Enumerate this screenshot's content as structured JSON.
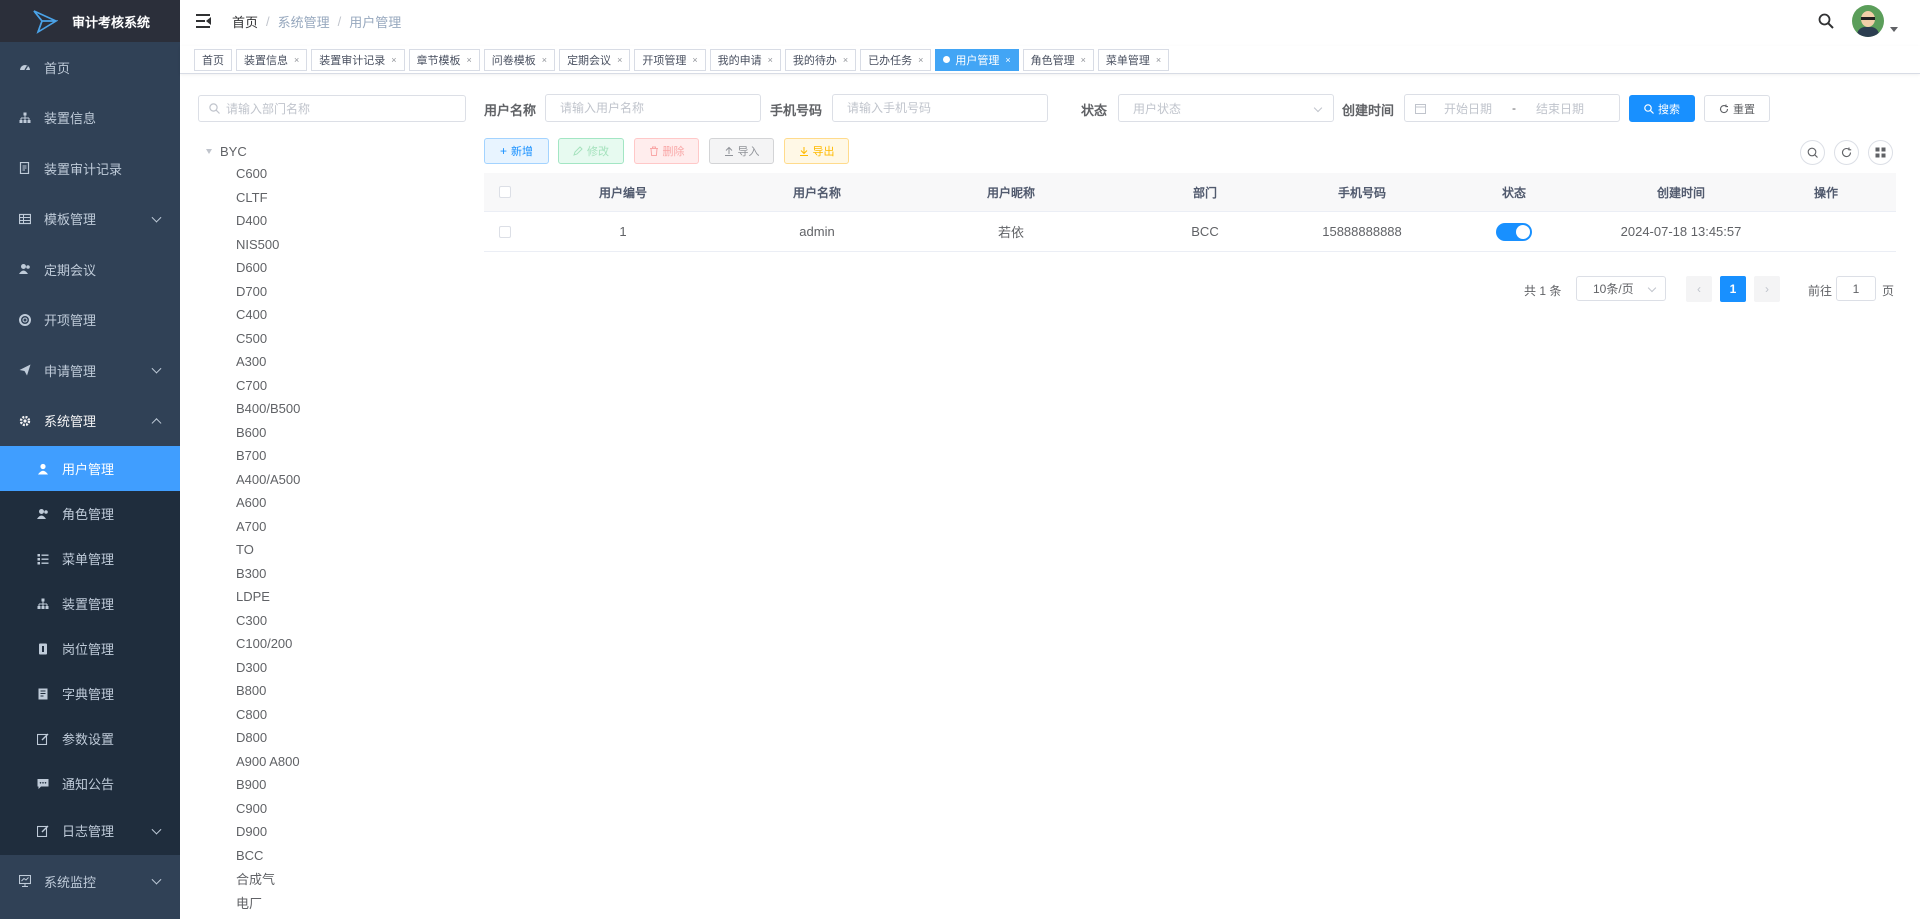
{
  "app": {
    "title": "审计考核系统"
  },
  "sidebar": {
    "items": [
      {
        "label": "首页",
        "icon": "dashboard-icon"
      },
      {
        "label": "装置信息",
        "icon": "tree-icon"
      },
      {
        "label": "装置审计记录",
        "icon": "document-icon"
      },
      {
        "label": "模板管理",
        "icon": "table-icon",
        "expandable": true
      },
      {
        "label": "定期会议",
        "icon": "people-icon"
      },
      {
        "label": "开项管理",
        "icon": "lifebuoy-icon"
      },
      {
        "label": "申请管理",
        "icon": "send-icon",
        "expandable": true
      },
      {
        "label": "系统管理",
        "icon": "gear-icon",
        "expanded": true
      }
    ],
    "system_submenu": [
      {
        "label": "用户管理",
        "icon": "user-icon",
        "active": true
      },
      {
        "label": "角色管理",
        "icon": "peoples-icon"
      },
      {
        "label": "菜单管理",
        "icon": "tree-table-icon"
      },
      {
        "label": "装置管理",
        "icon": "tree-icon"
      },
      {
        "label": "岗位管理",
        "icon": "post-icon"
      },
      {
        "label": "字典管理",
        "icon": "dict-icon"
      },
      {
        "label": "参数设置",
        "icon": "edit-icon"
      },
      {
        "label": "通知公告",
        "icon": "message-icon"
      },
      {
        "label": "日志管理",
        "icon": "log-icon",
        "expandable": true
      }
    ],
    "monitor": {
      "label": "系统监控",
      "icon": "monitor-icon",
      "expandable": true
    }
  },
  "header": {
    "breadcrumb": [
      "首页",
      "系统管理",
      "用户管理"
    ],
    "sep": "/"
  },
  "tags": [
    {
      "label": "首页",
      "closable": false
    },
    {
      "label": "装置信息",
      "closable": true
    },
    {
      "label": "装置审计记录",
      "closable": true
    },
    {
      "label": "章节模板",
      "closable": true
    },
    {
      "label": "问卷模板",
      "closable": true
    },
    {
      "label": "定期会议",
      "closable": true
    },
    {
      "label": "开项管理",
      "closable": true
    },
    {
      "label": "我的申请",
      "closable": true
    },
    {
      "label": "我的待办",
      "closable": true
    },
    {
      "label": "已办任务",
      "closable": true
    },
    {
      "label": "用户管理",
      "closable": true,
      "active": true
    },
    {
      "label": "角色管理",
      "closable": true
    },
    {
      "label": "菜单管理",
      "closable": true
    }
  ],
  "tag_close": "×",
  "dept_tree": {
    "search_placeholder": "请输入部门名称",
    "root": "BYC",
    "children": [
      "C600",
      "CLTF",
      "D400",
      "NIS500",
      "D600",
      "D700",
      "C400",
      "C500",
      "A300",
      "C700",
      "B400/B500",
      "B600",
      "B700",
      "A400/A500",
      "A600",
      "A700",
      "TO",
      "B300",
      "LDPE",
      "C300",
      "C100/200",
      "D300",
      "B800",
      "C800",
      "D800",
      "A900 A800",
      "B900",
      "C900",
      "D900",
      "BCC",
      "合成气",
      "电厂"
    ]
  },
  "query": {
    "username_label": "用户名称",
    "username_placeholder": "请输入用户名称",
    "phone_label": "手机号码",
    "phone_placeholder": "请输入手机号码",
    "status_label": "状态",
    "status_placeholder": "用户状态",
    "created_label": "创建时间",
    "start_placeholder": "开始日期",
    "range_sep": "-",
    "end_placeholder": "结束日期",
    "search_btn": "搜索",
    "reset_btn": "重置"
  },
  "toolbar": {
    "add": "新增",
    "edit": "修改",
    "delete": "删除",
    "import": "导入",
    "export": "导出"
  },
  "table": {
    "headers": [
      "用户编号",
      "用户名称",
      "用户昵称",
      "部门",
      "手机号码",
      "状态",
      "创建时间",
      "操作"
    ],
    "rows": [
      {
        "id": "1",
        "username": "admin",
        "nickname": "若依",
        "dept": "BCC",
        "phone": "15888888888",
        "status_on": true,
        "created": "2024-07-18 13:45:57",
        "ops": ""
      }
    ]
  },
  "pagination": {
    "total": "共 1 条",
    "page_size": "10条/页",
    "current": "1",
    "goto_label": "前往",
    "goto_value": "1",
    "page_unit": "页",
    "prev": "‹",
    "next": "›"
  },
  "colors": {
    "sidebar_bg": "#304156",
    "sidebar_active": "#409eff",
    "primary": "#1890ff",
    "tag_active": "#42a5f5"
  }
}
